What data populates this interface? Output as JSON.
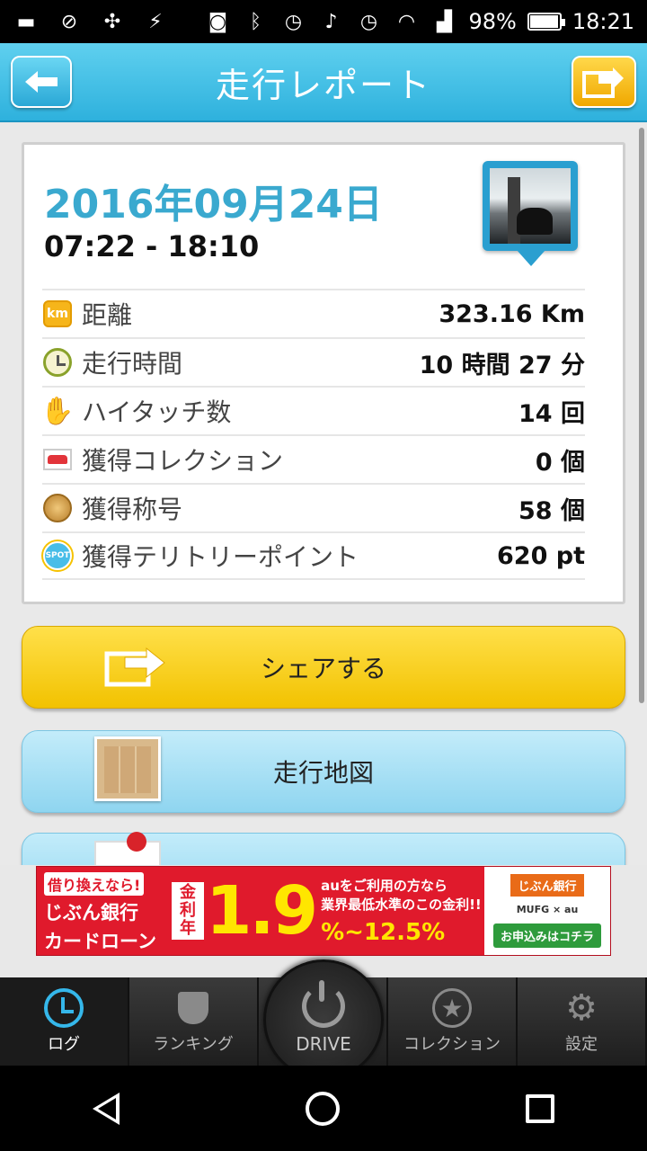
{
  "status_bar": {
    "battery_percent": "98%",
    "battery_level": 0.98,
    "time": "18:21",
    "icons": [
      "notification-icon",
      "location-off-icon",
      "satellite-icon",
      "battery-charging-icon",
      "voicemail-icon",
      "bluetooth-icon",
      "alarm-icon",
      "music-icon",
      "alarm-icon",
      "wifi-icon",
      "signal-icon"
    ]
  },
  "header": {
    "title": "走行レポート"
  },
  "report": {
    "date": "2016年09月24日",
    "time_range": "07:22 - 18:10",
    "rows": [
      {
        "icon": "km-icon",
        "icon_text": "km",
        "label": "距離",
        "value": "323.16 Km"
      },
      {
        "icon": "clock-icon",
        "label": "走行時間",
        "value": "10 時間 27 分"
      },
      {
        "icon": "hi-touch-hand-icon",
        "label": "ハイタッチ数",
        "value": "14 回"
      },
      {
        "icon": "car-icon",
        "label": "獲得コレクション",
        "value": "0 個"
      },
      {
        "icon": "medal-icon",
        "label": "獲得称号",
        "value": "58 個"
      },
      {
        "icon": "spot-icon",
        "icon_text": "SPOT",
        "label": "獲得テリトリーポイント",
        "value": "620 pt"
      }
    ]
  },
  "actions": {
    "share_label": "シェアする",
    "map_label": "走行地図"
  },
  "ad": {
    "small": "借り換えなら!",
    "title_line1": "じぶん銀行",
    "title_line2": "カードローン",
    "rate_label": "金利 年",
    "rate": "1.9",
    "line1": "auをご利用の方なら",
    "line2": "業界最低水準のこの金利!!",
    "range": "%~12.5%",
    "bank": "じぶん銀行",
    "logos": "MUFG × au",
    "cta": "お申込みはコチラ"
  },
  "tabbar": {
    "tabs": [
      {
        "label": "ログ",
        "icon": "log-clock-icon",
        "active": true
      },
      {
        "label": "ランキング",
        "icon": "trophy-icon",
        "active": false
      },
      {
        "label": "DRIVE",
        "icon": "power-icon",
        "active": false
      },
      {
        "label": "コレクション",
        "icon": "star-icon",
        "active": false
      },
      {
        "label": "設定",
        "icon": "gear-icon",
        "active": false
      }
    ]
  },
  "colors": {
    "header_blue": "#2eb1dd",
    "date_blue": "#3aa9cf",
    "share_yellow": "#f2c200",
    "map_blue": "#8fd5f0"
  }
}
